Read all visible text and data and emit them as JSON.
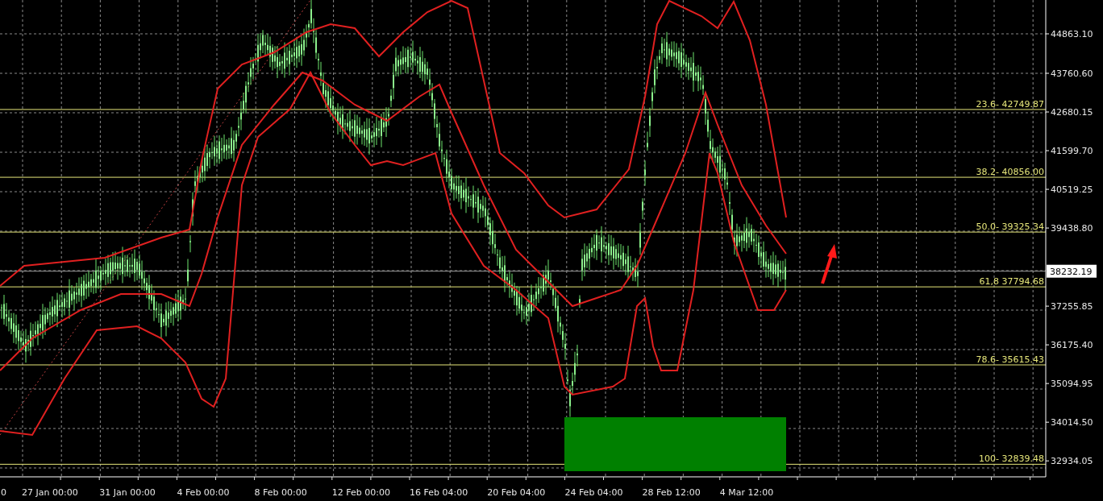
{
  "price_axis": {
    "labels": [
      "44863.10",
      "43760.60",
      "42680.15",
      "41599.70",
      "40519.25",
      "39438.80",
      "37255.85",
      "36175.40",
      "35094.95",
      "34014.50",
      "32934.05"
    ]
  },
  "current_price": "38232.19",
  "fibonacci_levels": [
    "23.6- 42749.87",
    "38.2- 40856.00",
    "50.0- 39325.34",
    "61,8 37794.68",
    "78.6- 35615.43",
    "100- 32839.48"
  ],
  "time_axis": {
    "labels": [
      "0",
      "27 Jan 00:00",
      "31 Jan 00:00",
      "4 Feb 00:00",
      "8 Feb 00:00",
      "12 Feb 00:00",
      "16 Feb 04:00",
      "20 Feb 04:00",
      "24 Feb 04:00",
      "28 Feb 12:00",
      "4 Mar 12:00"
    ]
  }
}
